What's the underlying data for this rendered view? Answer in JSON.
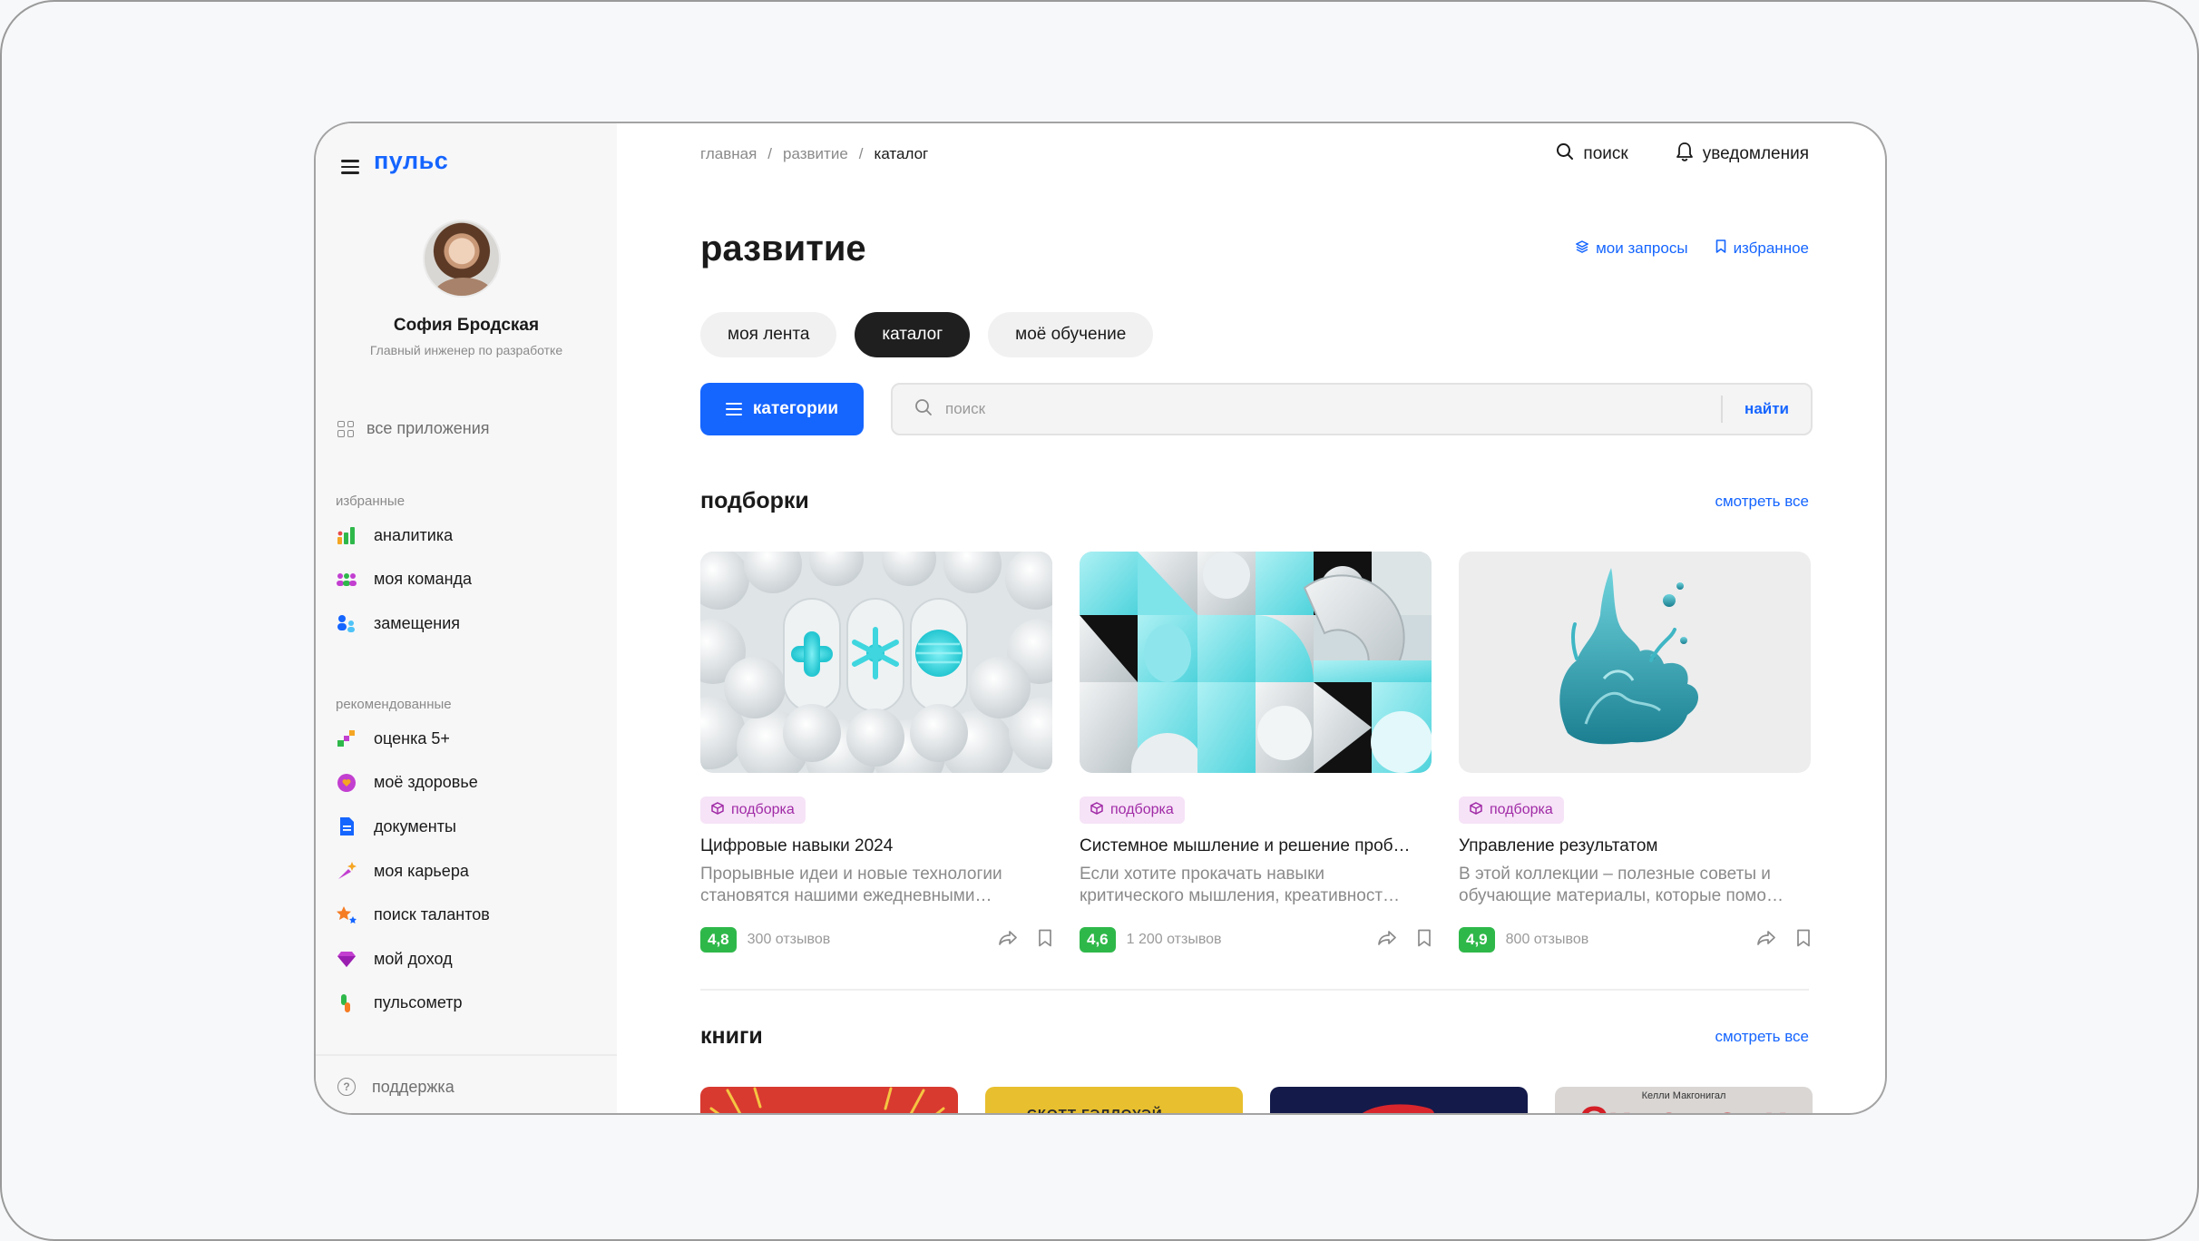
{
  "app": {
    "logo": "пульс"
  },
  "user": {
    "name": "София Бродская",
    "role": "Главный инженер по разработке"
  },
  "sidebar": {
    "all_apps": "все приложения",
    "favorites_label": "избранные",
    "favorites": [
      {
        "label": "аналитика",
        "icon": "analytics-icon"
      },
      {
        "label": "моя команда",
        "icon": "team-icon"
      },
      {
        "label": "замещения",
        "icon": "substitution-icon"
      }
    ],
    "recommended_label": "рекомендованные",
    "recommended": [
      {
        "label": "оценка 5+",
        "icon": "evaluation-icon"
      },
      {
        "label": "моё здоровье",
        "icon": "health-icon"
      },
      {
        "label": "документы",
        "icon": "document-icon"
      },
      {
        "label": "моя карьера",
        "icon": "career-icon"
      },
      {
        "label": "поиск талантов",
        "icon": "talent-icon"
      },
      {
        "label": "мой доход",
        "icon": "income-gem-icon"
      },
      {
        "label": "пульсометр",
        "icon": "pulse-meter-icon"
      }
    ],
    "support": "поддержка"
  },
  "header": {
    "breadcrumb": [
      "главная",
      "развитие",
      "каталог"
    ],
    "search": "поиск",
    "notifications": "уведомления"
  },
  "page": {
    "title": "развитие",
    "my_requests": "мои запросы",
    "favorites": "избранное",
    "tabs": [
      {
        "label": "моя лента",
        "active": false
      },
      {
        "label": "каталог",
        "active": true
      },
      {
        "label": "моё обучение",
        "active": false
      }
    ],
    "categories_button": "категории",
    "search_placeholder": "поиск",
    "search_button": "найти"
  },
  "collections": {
    "title": "подборки",
    "see_all": "смотреть все",
    "items": [
      {
        "badge": "подборка",
        "title": "Цифровые навыки 2024",
        "description": "Прорывные идеи и новые технологии становятся нашими ежедневными…",
        "rating": "4,8",
        "reviews": "300 отзывов"
      },
      {
        "badge": "подборка",
        "title": "Системное мышление и решение проб…",
        "description": "Если хотите прокачать навыки критического мышления, креативност…",
        "rating": "4,6",
        "reviews": "1 200 отзывов"
      },
      {
        "badge": "подборка",
        "title": "Управление результатом",
        "description": "В этой коллекции – полезные советы и обучающие материалы, которые помо…",
        "rating": "4,9",
        "reviews": "800 отзывов"
      }
    ]
  },
  "books": {
    "title": "книги",
    "see_all": "смотреть все",
    "covers": [
      {
        "text": ""
      },
      {
        "text": "СКОТТ ГЭЛЛОУЭЙ"
      },
      {
        "text": ""
      },
      {
        "author": "Келли Макгонигал",
        "title": "Сила воли"
      }
    ]
  },
  "colors": {
    "accent": "#1565ff",
    "rating": "#2fb84a",
    "badge_bg": "#f6e3f7",
    "badge_fg": "#a02aa6"
  }
}
